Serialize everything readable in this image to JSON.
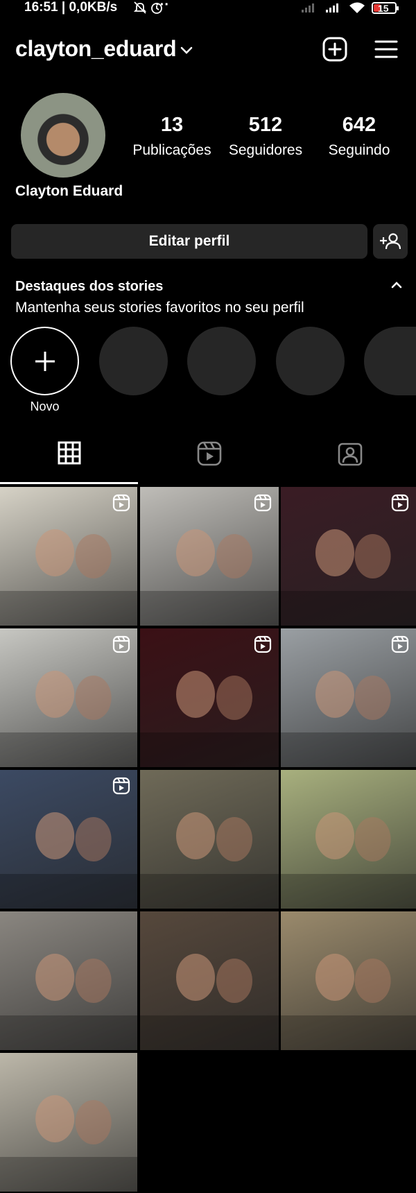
{
  "status_bar": {
    "time": "16:51 | 0,0KB/s",
    "battery": "15"
  },
  "header": {
    "username": "clayton_eduard"
  },
  "profile": {
    "name": "Clayton Eduard",
    "stats": [
      {
        "value": "13",
        "label": "Publicações"
      },
      {
        "value": "512",
        "label": "Seguidores"
      },
      {
        "value": "642",
        "label": "Seguindo"
      }
    ],
    "edit_label": "Editar perfil"
  },
  "highlights": {
    "title": "Destaques dos stories",
    "subtitle": "Mantenha seus stories favoritos no seu perfil",
    "new_label": "Novo"
  },
  "tabs": [
    {
      "icon": "grid-icon",
      "active": true
    },
    {
      "icon": "reels-icon",
      "active": false
    },
    {
      "icon": "tagged-icon",
      "active": false
    }
  ],
  "posts": [
    {
      "reel": true,
      "bg": "#d6d2c6"
    },
    {
      "reel": true,
      "bg": "#bfbdb8"
    },
    {
      "reel": true,
      "bg": "#3a1c24"
    },
    {
      "reel": true,
      "bg": "#c7c7c2"
    },
    {
      "reel": true,
      "bg": "#3b1015"
    },
    {
      "reel": true,
      "bg": "#9a9fa3"
    },
    {
      "reel": true,
      "bg": "#3c4a63"
    },
    {
      "reel": false,
      "bg": "#6f6a58"
    },
    {
      "reel": false,
      "bg": "#a8b07e"
    },
    {
      "reel": false,
      "bg": "#8a8680"
    },
    {
      "reel": false,
      "bg": "#56483c"
    },
    {
      "reel": false,
      "bg": "#9a8a6c"
    },
    {
      "reel": false,
      "bg": "#bcb7a9"
    }
  ]
}
